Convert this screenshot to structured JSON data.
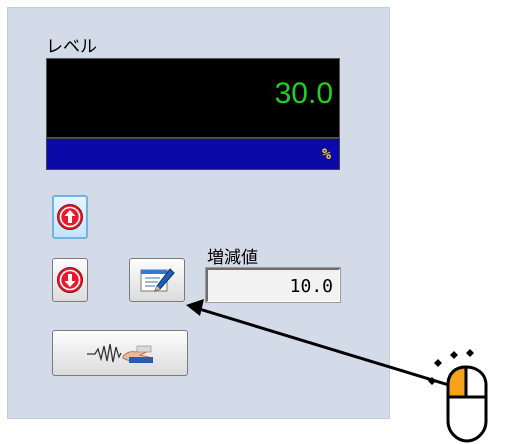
{
  "panel": {
    "level_label": "レベル",
    "level_value": "30.0",
    "unit": "%",
    "step_label": "増減値",
    "step_value": "10.0"
  },
  "buttons": {
    "up_icon": "arrow-up-circle-icon",
    "down_icon": "arrow-down-circle-icon",
    "edit_icon": "edit-note-icon",
    "wave_icon": "wave-hand-icon"
  },
  "colors": {
    "display_text": "#1fd11f",
    "unit_bar": "#0a0aa8",
    "unit_text": "#ffd21a",
    "arrow_red": "#e8192c",
    "panel_bg": "#d3dbe8",
    "mouse_orange": "#f7a21b"
  },
  "overlay": {
    "cursor_icon": "mouse-click-icon",
    "pointer_arrow": "arrow-pointer"
  }
}
